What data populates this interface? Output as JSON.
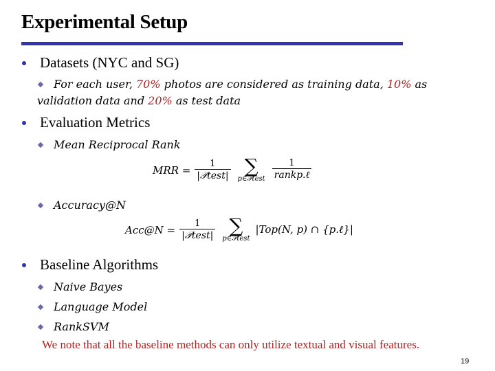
{
  "slide": {
    "title": "Experimental Setup",
    "accent_color": "#3333aa",
    "highlight_color": "#b22222",
    "page_number": "19"
  },
  "sections": [
    {
      "heading": "Datasets (NYC and SG)",
      "items": [
        {
          "parts": [
            "For each user, ",
            "70%",
            " photos are considered as training data, ",
            "10%",
            " as",
            "validation data and ",
            "20%",
            " as test data"
          ]
        }
      ]
    },
    {
      "heading": "Evaluation Metrics",
      "items": [
        {
          "label": "Mean Reciprocal Rank"
        },
        {
          "label": "Accuracy@N"
        }
      ]
    },
    {
      "heading": "Baseline Algorithms",
      "items": [
        {
          "label": "Naive Bayes"
        },
        {
          "label": "Language Model"
        },
        {
          "label": "RankSVM"
        }
      ]
    }
  ],
  "equations": {
    "mrr": {
      "lhs": "MRR =",
      "num": "1",
      "den": "|𝒫test|",
      "sum_sub": "p∈𝒫test",
      "term_num": "1",
      "term_den": "rankp.ℓ"
    },
    "acc": {
      "lhs": "Acc@N =",
      "num": "1",
      "den": "|𝒫test|",
      "sum_sub": "p∈𝒫test",
      "term": "|Top(N, p) ∩ {p.ℓ}|"
    }
  },
  "note": "We note that all the baseline methods can only utilize textual and visual features."
}
